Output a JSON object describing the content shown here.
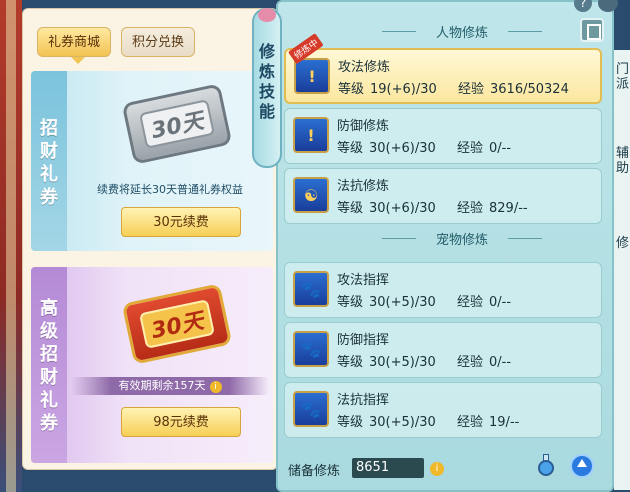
{
  "shop": {
    "tabs": [
      "礼券商城",
      "积分兑换"
    ],
    "cards": [
      {
        "title": "招财礼券",
        "ticket": "30天",
        "desc": "续费将延长30天普通礼券权益",
        "button": "30元续费"
      },
      {
        "title": "高级招财礼券",
        "ticket": "30天",
        "desc": "有效期剩余157天",
        "button": "98元续费"
      }
    ]
  },
  "side_tab": {
    "label": "修炼技能"
  },
  "skill_panel": {
    "sections": [
      {
        "title": "人物修炼",
        "items": [
          {
            "name": "攻法修炼",
            "level_label": "等级",
            "level": "19(+6)/30",
            "exp_label": "经验",
            "exp": "3616/50324",
            "badge": "修炼中",
            "active": true,
            "icon": "attack-magic-icon",
            "glyph": "!"
          },
          {
            "name": "防御修炼",
            "level_label": "等级",
            "level": "30(+6)/30",
            "exp_label": "经验",
            "exp": "0/--",
            "icon": "defense-icon",
            "glyph": "!"
          },
          {
            "name": "法抗修炼",
            "level_label": "等级",
            "level": "30(+6)/30",
            "exp_label": "经验",
            "exp": "829/--",
            "icon": "magic-resist-icon",
            "glyph": "☯"
          }
        ]
      },
      {
        "title": "宠物修炼",
        "items": [
          {
            "name": "攻法指挥",
            "level_label": "等级",
            "level": "30(+5)/30",
            "exp_label": "经验",
            "exp": "0/--",
            "icon": "pet-attack-icon",
            "glyph": "🐾"
          },
          {
            "name": "防御指挥",
            "level_label": "等级",
            "level": "30(+5)/30",
            "exp_label": "经验",
            "exp": "0/--",
            "icon": "pet-defense-icon",
            "glyph": "🐾"
          },
          {
            "name": "法抗指挥",
            "level_label": "等级",
            "level": "30(+5)/30",
            "exp_label": "经验",
            "exp": "19/--",
            "icon": "pet-resist-icon",
            "glyph": "🐾"
          }
        ]
      }
    ],
    "storage_label": "储备修炼",
    "storage_value": "8651"
  },
  "right_edge": [
    "门派",
    "辅助",
    "修"
  ]
}
